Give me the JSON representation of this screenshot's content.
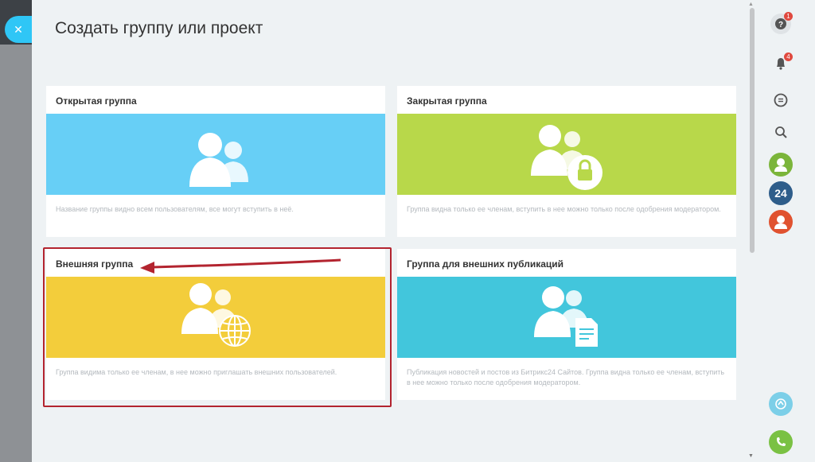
{
  "page": {
    "title": "Создать группу или проект"
  },
  "close_button": {
    "label": "✕"
  },
  "cards": [
    {
      "title": "Открытая группа",
      "description": "Название группы видно всем пользователям, все могут вступить в неё.",
      "color": "#67cff6"
    },
    {
      "title": "Закрытая группа",
      "description": "Группа видна только ее членам, вступить в нее можно только после одобрения модератором.",
      "color": "#b8d84a"
    },
    {
      "title": "Внешняя группа",
      "description": "Группа видима только ее членам, в нее можно приглашать внешних пользователей.",
      "color": "#f3cd3b"
    },
    {
      "title": "Группа для внешних публикаций",
      "description": "Публикация новостей и постов из Битрикс24 Сайтов. Группа видна только ее членам, вступить в нее можно только после одобрения модератором.",
      "color": "#42c6dc"
    }
  ],
  "right_panel": {
    "help_badge": "1",
    "notifications_badge": "4",
    "counter_label": "24"
  },
  "colors": {
    "highlight": "#b3242f",
    "accent": "#2fc6f6"
  }
}
